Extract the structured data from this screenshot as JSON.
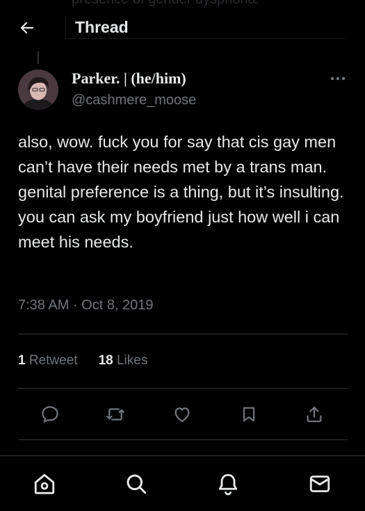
{
  "header": {
    "title": "Thread",
    "back_icon": "arrow-left-icon"
  },
  "above_context": {
    "partial_text": "presence of gender dysphoria."
  },
  "tweet": {
    "author_name": "Parker. | (he/him)",
    "author_handle": "@cashmere_moose",
    "text": "also, wow. fuck you for say that cis gay men can’t have their needs met by a trans man. genital preference is a thing, but it’s insulting. you can ask my boyfriend just how well i can meet his needs.",
    "timestamp": "7:38 AM · Oct 8, 2019",
    "retweets_count": "1",
    "retweets_label": "Retweet",
    "likes_count": "18",
    "likes_label": "Likes"
  },
  "actions": [
    "reply-icon",
    "retweet-icon",
    "like-icon",
    "bookmark-icon",
    "share-icon"
  ],
  "nav": [
    "home-icon",
    "search-icon",
    "notifications-icon",
    "messages-icon"
  ],
  "colors": {
    "background": "#000000",
    "text_primary": "#e7e9ea",
    "text_secondary": "#71767b",
    "divider": "#2f3336"
  }
}
